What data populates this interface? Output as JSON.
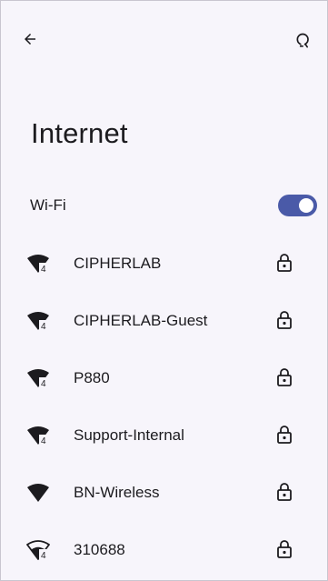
{
  "header": {
    "back_icon": "arrow-back-icon",
    "help_icon": "help-feedback-icon",
    "title": "Internet"
  },
  "wifi": {
    "label": "Wi-Fi",
    "enabled": true,
    "toggle_color": "#4a5aa8"
  },
  "networks": [
    {
      "name": "CIPHERLAB",
      "secured": true,
      "signal_icon": "wifi-4-full-icon"
    },
    {
      "name": "CIPHERLAB-Guest",
      "secured": true,
      "signal_icon": "wifi-4-full-icon"
    },
    {
      "name": "P880",
      "secured": true,
      "signal_icon": "wifi-4-full-icon"
    },
    {
      "name": "Support-Internal",
      "secured": true,
      "signal_icon": "wifi-4-full-icon"
    },
    {
      "name": "BN-Wireless",
      "secured": true,
      "signal_icon": "wifi-full-icon"
    },
    {
      "name": "310688",
      "secured": true,
      "signal_icon": "wifi-4-partial-icon"
    }
  ]
}
